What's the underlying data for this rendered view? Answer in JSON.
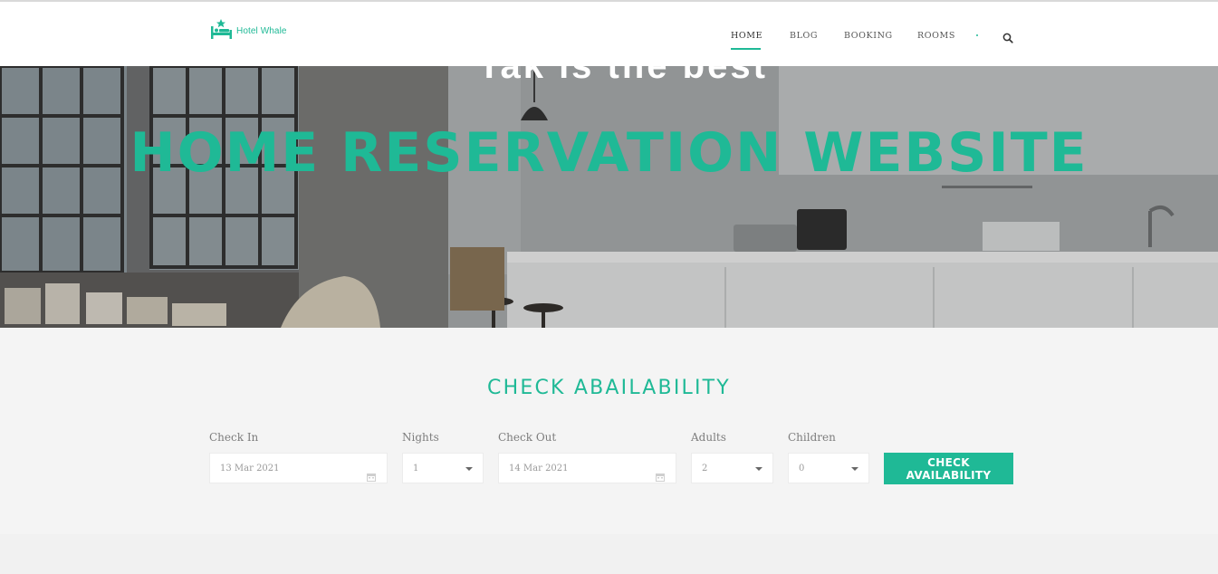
{
  "brand": {
    "name": "Hotel Whale",
    "accent": "#1fb996"
  },
  "nav": {
    "items": [
      {
        "label": "HOME",
        "active": true
      },
      {
        "label": "BLOG",
        "active": false
      },
      {
        "label": "BOOKING",
        "active": false
      },
      {
        "label": "ROOMS",
        "active": false
      }
    ],
    "search_icon": "search-icon"
  },
  "hero": {
    "cut_off_text": "Tak is the best",
    "title": "HOME RESERVATION WEBSITE"
  },
  "booking": {
    "heading": "CHECK ABAILABILITY",
    "check_in": {
      "label": "Check In",
      "value": "13 Mar 2021",
      "icon": "calendar-icon"
    },
    "nights": {
      "label": "Nights",
      "value": "1"
    },
    "check_out": {
      "label": "Check Out",
      "value": "14 Mar 2021",
      "icon": "calendar-icon"
    },
    "adults": {
      "label": "Adults",
      "value": "2"
    },
    "children": {
      "label": "Children",
      "value": "0"
    },
    "submit_label": "CHECK AVAILABILITY"
  }
}
